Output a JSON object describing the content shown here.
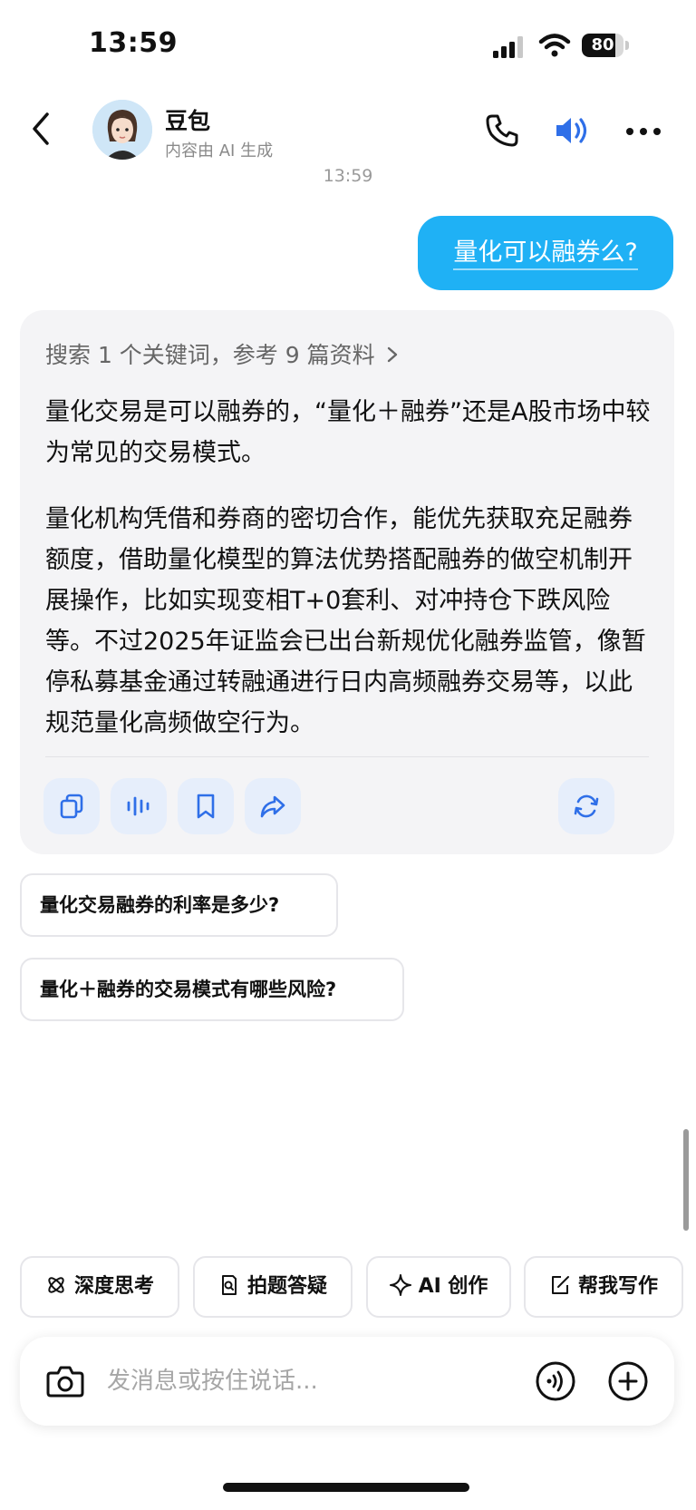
{
  "status_bar": {
    "time": "13:59",
    "battery": "80",
    "battery_level": 0.8
  },
  "header": {
    "title": "豆包",
    "subtitle": "内容由 AI 生成"
  },
  "chat": {
    "timestamp": "13:59",
    "user_message": "量化可以融券么?",
    "answer": {
      "search_summary": "搜索 1 个关键词，参考 9 篇资料",
      "paragraphs": [
        "量化交易是可以融券的，“量化＋融券”还是A股市场中较为常见的交易模式。",
        "量化机构凭借和券商的密切合作，能优先获取充足融券额度，借助量化模型的算法优势搭配融券的做空机制开展操作，比如实现变相T+0套利、对冲持仓下跌风险等。不过2025年证监会已出台新规优化融券监管，像暂停私募基金通过转融通进行日内高频融券交易等，以此规范量化高频做空行为。"
      ],
      "actions": [
        "copy-icon",
        "voice-play-icon",
        "bookmark-icon",
        "share-icon",
        "regenerate-icon"
      ]
    },
    "suggestions": [
      "量化交易融券的利率是多少?",
      "量化＋融券的交易模式有哪些风险?"
    ]
  },
  "quick_actions": [
    {
      "label": "深度思考",
      "icon": "atom-icon"
    },
    {
      "label": "拍题答疑",
      "icon": "doc-search-icon"
    },
    {
      "label": "AI 创作",
      "icon": "sparkle-icon"
    },
    {
      "label": "帮我写作",
      "icon": "edit-icon"
    }
  ],
  "input": {
    "placeholder": "发消息或按住说话..."
  },
  "colors": {
    "accent": "#1fb1f5",
    "action_icon": "#2f6fe8",
    "card_bg": "#f4f4f6"
  }
}
